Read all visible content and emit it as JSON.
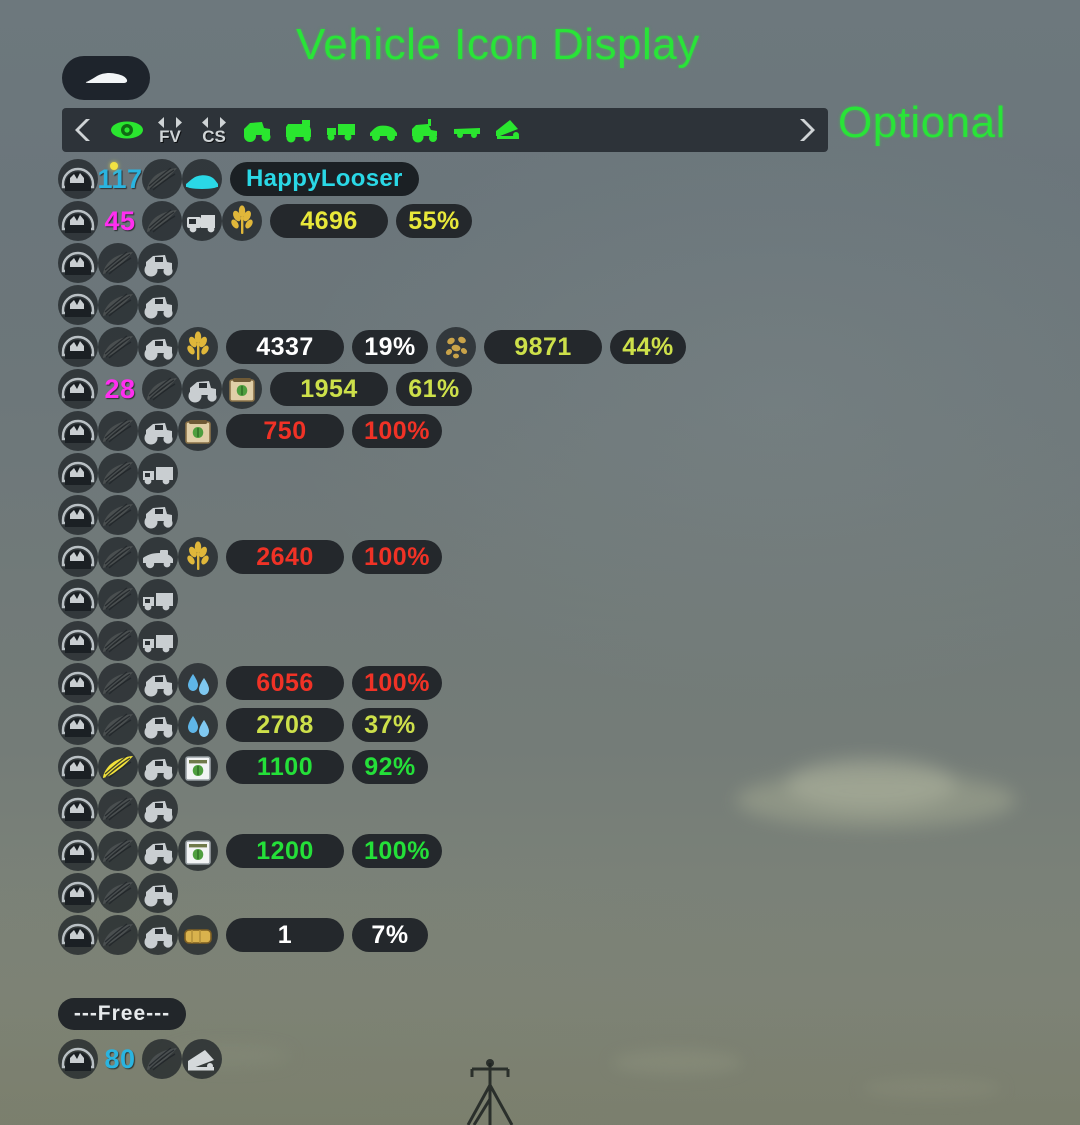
{
  "annotations": {
    "title": "Vehicle Icon Display",
    "optional": "Optional",
    "title_color": "#29e438"
  },
  "toolbar": {
    "prev_label": "❮",
    "next_label": "❯",
    "fv_label": "FV",
    "cs_label": "CS",
    "icons": [
      {
        "name": "eye-icon",
        "label": "Visibility"
      },
      {
        "name": "fv-stepper",
        "label": "FV"
      },
      {
        "name": "cs-stepper",
        "label": "CS"
      },
      {
        "name": "tractor-icon",
        "label": "Tractor"
      },
      {
        "name": "combine-icon",
        "label": "Combine"
      },
      {
        "name": "truck-icon",
        "label": "Truck"
      },
      {
        "name": "car-icon",
        "label": "Car"
      },
      {
        "name": "loader-icon",
        "label": "Loader"
      },
      {
        "name": "trailer-icon",
        "label": "Trailer"
      },
      {
        "name": "implement-icon",
        "label": "Implement"
      }
    ]
  },
  "vehicle_toggle": {
    "icon": "car-icon"
  },
  "list": {
    "rows": [
      {
        "id": "117",
        "id_color": "#2ab4e0",
        "has_marker": true,
        "status_icon": "helmet-icon",
        "field_icon": "field-icon",
        "vehicle_icon": "car-icon",
        "vehicle_color": "#2ad8e6",
        "fill_icon": null,
        "amount": null,
        "percent": null,
        "name": "HappyLooser",
        "name_color": "#2ad8e6"
      },
      {
        "id": "45",
        "id_color": "#ff2ef0",
        "has_marker": false,
        "status_icon": "helmet-icon",
        "field_icon": "field-icon",
        "vehicle_icon": "combine-icon",
        "vehicle_color": "#d5d9db",
        "fill_icon": "wheat-icon",
        "amount": "4696",
        "percent": "55%",
        "value_color": "#e8e83a"
      },
      {
        "id": null,
        "status_icon": "helmet-icon",
        "field_icon": "field-icon",
        "vehicle_icon": "tractor-icon",
        "vehicle_color": "#c9ced1",
        "fill_icon": null,
        "amount": null,
        "percent": null
      },
      {
        "id": null,
        "status_icon": "helmet-icon",
        "field_icon": "field-icon",
        "vehicle_icon": "tractor-icon",
        "vehicle_color": "#c9ced1",
        "fill_icon": null,
        "amount": null,
        "percent": null
      },
      {
        "id": null,
        "status_icon": "helmet-icon",
        "field_icon": "field-icon",
        "vehicle_icon": "tractor-icon",
        "vehicle_color": "#c9ced1",
        "fill_icon": "wheat-icon",
        "amount": "4337",
        "percent": "19%",
        "value_color": "#ffffff",
        "fill_icon2": "chaff-icon",
        "amount2": "9871",
        "percent2": "44%",
        "value_color2": "#cde04a"
      },
      {
        "id": "28",
        "id_color": "#ff2ef0",
        "status_icon": "helmet-icon",
        "field_icon": "field-icon",
        "vehicle_icon": "tractor-icon",
        "vehicle_color": "#c9ced1",
        "fill_icon": "seed-bag-icon",
        "amount": "1954",
        "percent": "61%",
        "value_color": "#cde04a"
      },
      {
        "id": null,
        "status_icon": "helmet-icon",
        "field_icon": "field-icon",
        "vehicle_icon": "tractor-icon",
        "vehicle_color": "#c9ced1",
        "fill_icon": "seed-bag-icon",
        "amount": "750",
        "percent": "100%",
        "value_color": "#f03226"
      },
      {
        "id": null,
        "status_icon": "helmet-icon",
        "field_icon": "field-icon",
        "vehicle_icon": "truck-icon",
        "vehicle_color": "#c9ced1",
        "fill_icon": null,
        "amount": null,
        "percent": null
      },
      {
        "id": null,
        "status_icon": "helmet-icon",
        "field_icon": "field-icon",
        "vehicle_icon": "tractor-icon",
        "vehicle_color": "#c9ced1",
        "fill_icon": null,
        "amount": null,
        "percent": null
      },
      {
        "id": null,
        "status_icon": "helmet-icon",
        "field_icon": "field-icon",
        "vehicle_icon": "harvester-icon",
        "vehicle_color": "#c9ced1",
        "fill_icon": "wheat-icon",
        "amount": "2640",
        "percent": "100%",
        "value_color": "#f03226"
      },
      {
        "id": null,
        "status_icon": "helmet-icon",
        "field_icon": "field-icon",
        "vehicle_icon": "truck-icon",
        "vehicle_color": "#c9ced1",
        "fill_icon": null,
        "amount": null,
        "percent": null
      },
      {
        "id": null,
        "status_icon": "helmet-icon",
        "field_icon": "field-icon",
        "vehicle_icon": "truck-icon",
        "vehicle_color": "#c9ced1",
        "fill_icon": null,
        "amount": null,
        "percent": null
      },
      {
        "id": null,
        "status_icon": "helmet-icon",
        "field_icon": "field-icon",
        "vehicle_icon": "tractor-icon",
        "vehicle_color": "#c9ced1",
        "fill_icon": "water-icon",
        "amount": "6056",
        "percent": "100%",
        "value_color": "#f03226"
      },
      {
        "id": null,
        "status_icon": "helmet-icon",
        "field_icon": "field-icon",
        "vehicle_icon": "tractor-icon",
        "vehicle_color": "#c9ced1",
        "fill_icon": "water-icon",
        "amount": "2708",
        "percent": "37%",
        "value_color": "#cde04a"
      },
      {
        "id": null,
        "status_icon": "helmet-icon",
        "field_icon": "field-icon",
        "field_color": "#f2e23a",
        "vehicle_icon": "tractor-icon",
        "vehicle_color": "#c9ced1",
        "fill_icon": "fertilizer-icon",
        "amount": "1100",
        "percent": "92%",
        "value_color": "#24e039"
      },
      {
        "id": null,
        "status_icon": "helmet-icon",
        "field_icon": "field-icon",
        "vehicle_icon": "tractor-icon",
        "vehicle_color": "#c9ced1",
        "fill_icon": null,
        "amount": null,
        "percent": null
      },
      {
        "id": null,
        "status_icon": "helmet-icon",
        "field_icon": "field-icon",
        "vehicle_icon": "tractor-icon",
        "vehicle_color": "#c9ced1",
        "fill_icon": "fertilizer-icon",
        "amount": "1200",
        "percent": "100%",
        "value_color": "#24e039"
      },
      {
        "id": null,
        "status_icon": "helmet-icon",
        "field_icon": "field-icon",
        "vehicle_icon": "tractor-icon",
        "vehicle_color": "#c9ced1",
        "fill_icon": null,
        "amount": null,
        "percent": null
      },
      {
        "id": null,
        "status_icon": "helmet-icon",
        "field_icon": "field-icon",
        "vehicle_icon": "tractor-icon",
        "vehicle_color": "#c9ced1",
        "fill_icon": "bale-icon",
        "amount": "1",
        "percent": "7%",
        "value_color": "#ffffff"
      }
    ]
  },
  "free_section": {
    "label": "---Free---",
    "rows": [
      {
        "id": "80",
        "id_color": "#2ab4e0",
        "status_icon": "helmet-icon",
        "field_icon": "field-icon",
        "vehicle_icon": "implement-icon",
        "vehicle_color": "#d5d9db"
      }
    ]
  }
}
